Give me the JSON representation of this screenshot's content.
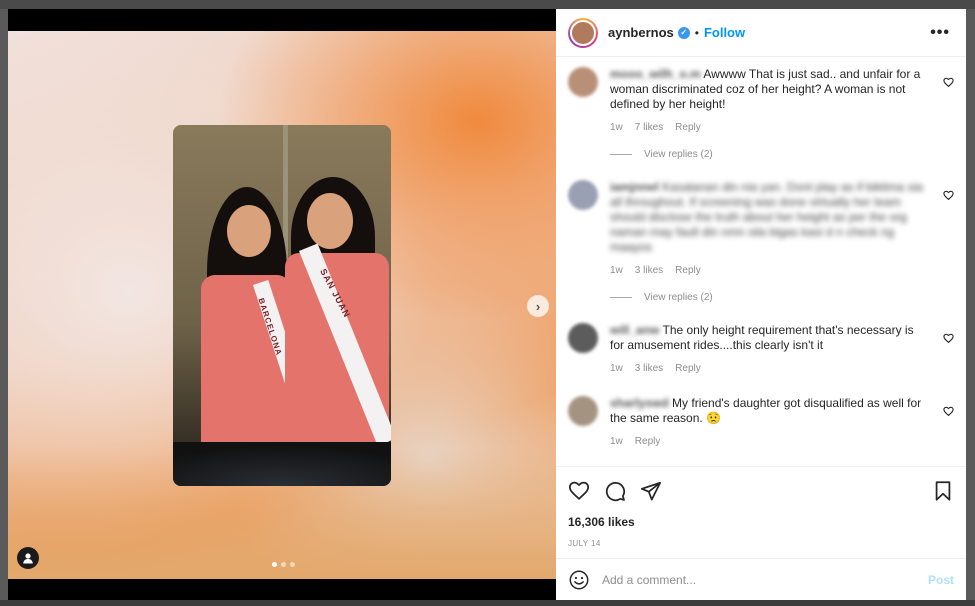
{
  "post": {
    "username": "aynbernos",
    "follow_label": "Follow",
    "separator": "•",
    "more_label": "•••",
    "next_label": "›",
    "photo_sash_left": "BARCELONA",
    "photo_sash_right": "SAN JUAN",
    "carousel": {
      "count": 3,
      "active": 1
    }
  },
  "comments": [
    {
      "name": "mooo_wilh_o.m",
      "text": "Awwww That is just sad.. and unfair for a woman discriminated coz of her height? A woman is not defined by her height!",
      "blurred": false,
      "age": "1w",
      "likes": "7 likes",
      "reply": "Reply",
      "view_replies": "View replies (2)",
      "avatar_color": "#b98f77"
    },
    {
      "name": "iamjnnel",
      "text": "Kasalanan din nia yan. Dont play as if biktima sia all throughout. If screening was done virtually her team should disclose the truth about her height as per the org naman may fault din nmn sila bigas kasi d n check ng maayos",
      "blurred": true,
      "age": "1w",
      "likes": "3 likes",
      "reply": "Reply",
      "view_replies": "View replies (2)",
      "avatar_color": "#9aa0b4"
    },
    {
      "name": "will_anw",
      "text": "The only height requirement that's necessary is for amusement rides....this clearly isn't it",
      "blurred": false,
      "age": "1w",
      "likes": "3 likes",
      "reply": "Reply",
      "avatar_color": "#5c5c5c"
    },
    {
      "name": "sharlyswd",
      "text": "My friend's daughter got disqualified as well for the same reason. 😟",
      "blurred": false,
      "age": "1w",
      "reply": "Reply",
      "avatar_color": "#a59382"
    }
  ],
  "footer": {
    "likes": "16,306 likes",
    "date": "JULY 14",
    "comment_placeholder": "Add a comment...",
    "post_label": "Post"
  }
}
